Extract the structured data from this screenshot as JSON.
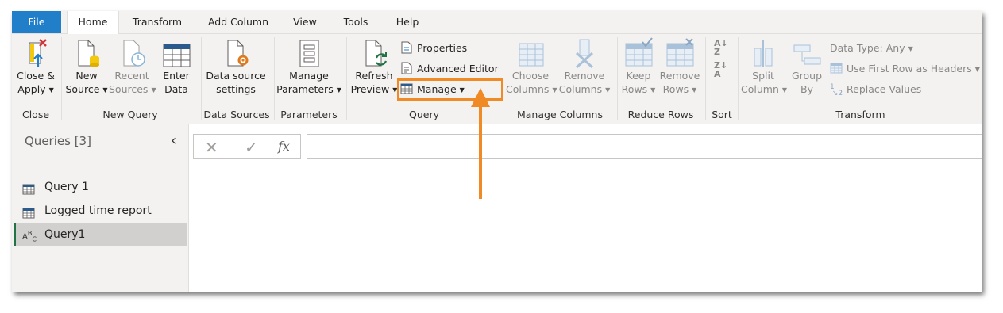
{
  "tabs": [
    "File",
    "Home",
    "Transform",
    "Add Column",
    "View",
    "Tools",
    "Help"
  ],
  "ribbon": {
    "close_group": {
      "label": "Close",
      "close_apply": [
        "Close &",
        "Apply"
      ]
    },
    "new_query_group": {
      "label": "New Query",
      "new_source": [
        "New",
        "Source"
      ],
      "recent_sources": [
        "Recent",
        "Sources"
      ],
      "enter_data": [
        "Enter",
        "Data"
      ]
    },
    "data_sources_group": {
      "label": "Data Sources",
      "data_source_settings": [
        "Data source",
        "settings"
      ]
    },
    "parameters_group": {
      "label": "Parameters",
      "manage_parameters": [
        "Manage",
        "Parameters"
      ]
    },
    "query_group": {
      "label": "Query",
      "refresh_preview": [
        "Refresh",
        "Preview"
      ],
      "properties": "Properties",
      "advanced_editor": "Advanced Editor",
      "manage": "Manage"
    },
    "manage_columns_group": {
      "label": "Manage Columns",
      "choose_columns": [
        "Choose",
        "Columns"
      ],
      "remove_columns": [
        "Remove",
        "Columns"
      ]
    },
    "reduce_rows_group": {
      "label": "Reduce Rows",
      "keep_rows": [
        "Keep",
        "Rows"
      ],
      "remove_rows": [
        "Remove",
        "Rows"
      ]
    },
    "sort_group": {
      "label": "Sort"
    },
    "transform_group": {
      "label": "Transform",
      "split_column": [
        "Split",
        "Column"
      ],
      "group_by": [
        "Group",
        "By"
      ],
      "data_type": "Data Type: Any",
      "use_first_row": "Use First Row as Headers",
      "replace_values": "Replace Values"
    }
  },
  "queries_pane": {
    "title": "Queries [3]",
    "items": [
      {
        "label": "Query 1",
        "icon": "table-icon"
      },
      {
        "label": "Logged time report",
        "icon": "table-icon"
      },
      {
        "label": "Query1",
        "icon": "abc-text-icon",
        "selected": true
      }
    ]
  },
  "formula_bar": {
    "fx": "fx",
    "value": ""
  },
  "colors": {
    "accent": "#217ec9",
    "highlight": "#f08a24",
    "selected_bar": "#217346"
  }
}
